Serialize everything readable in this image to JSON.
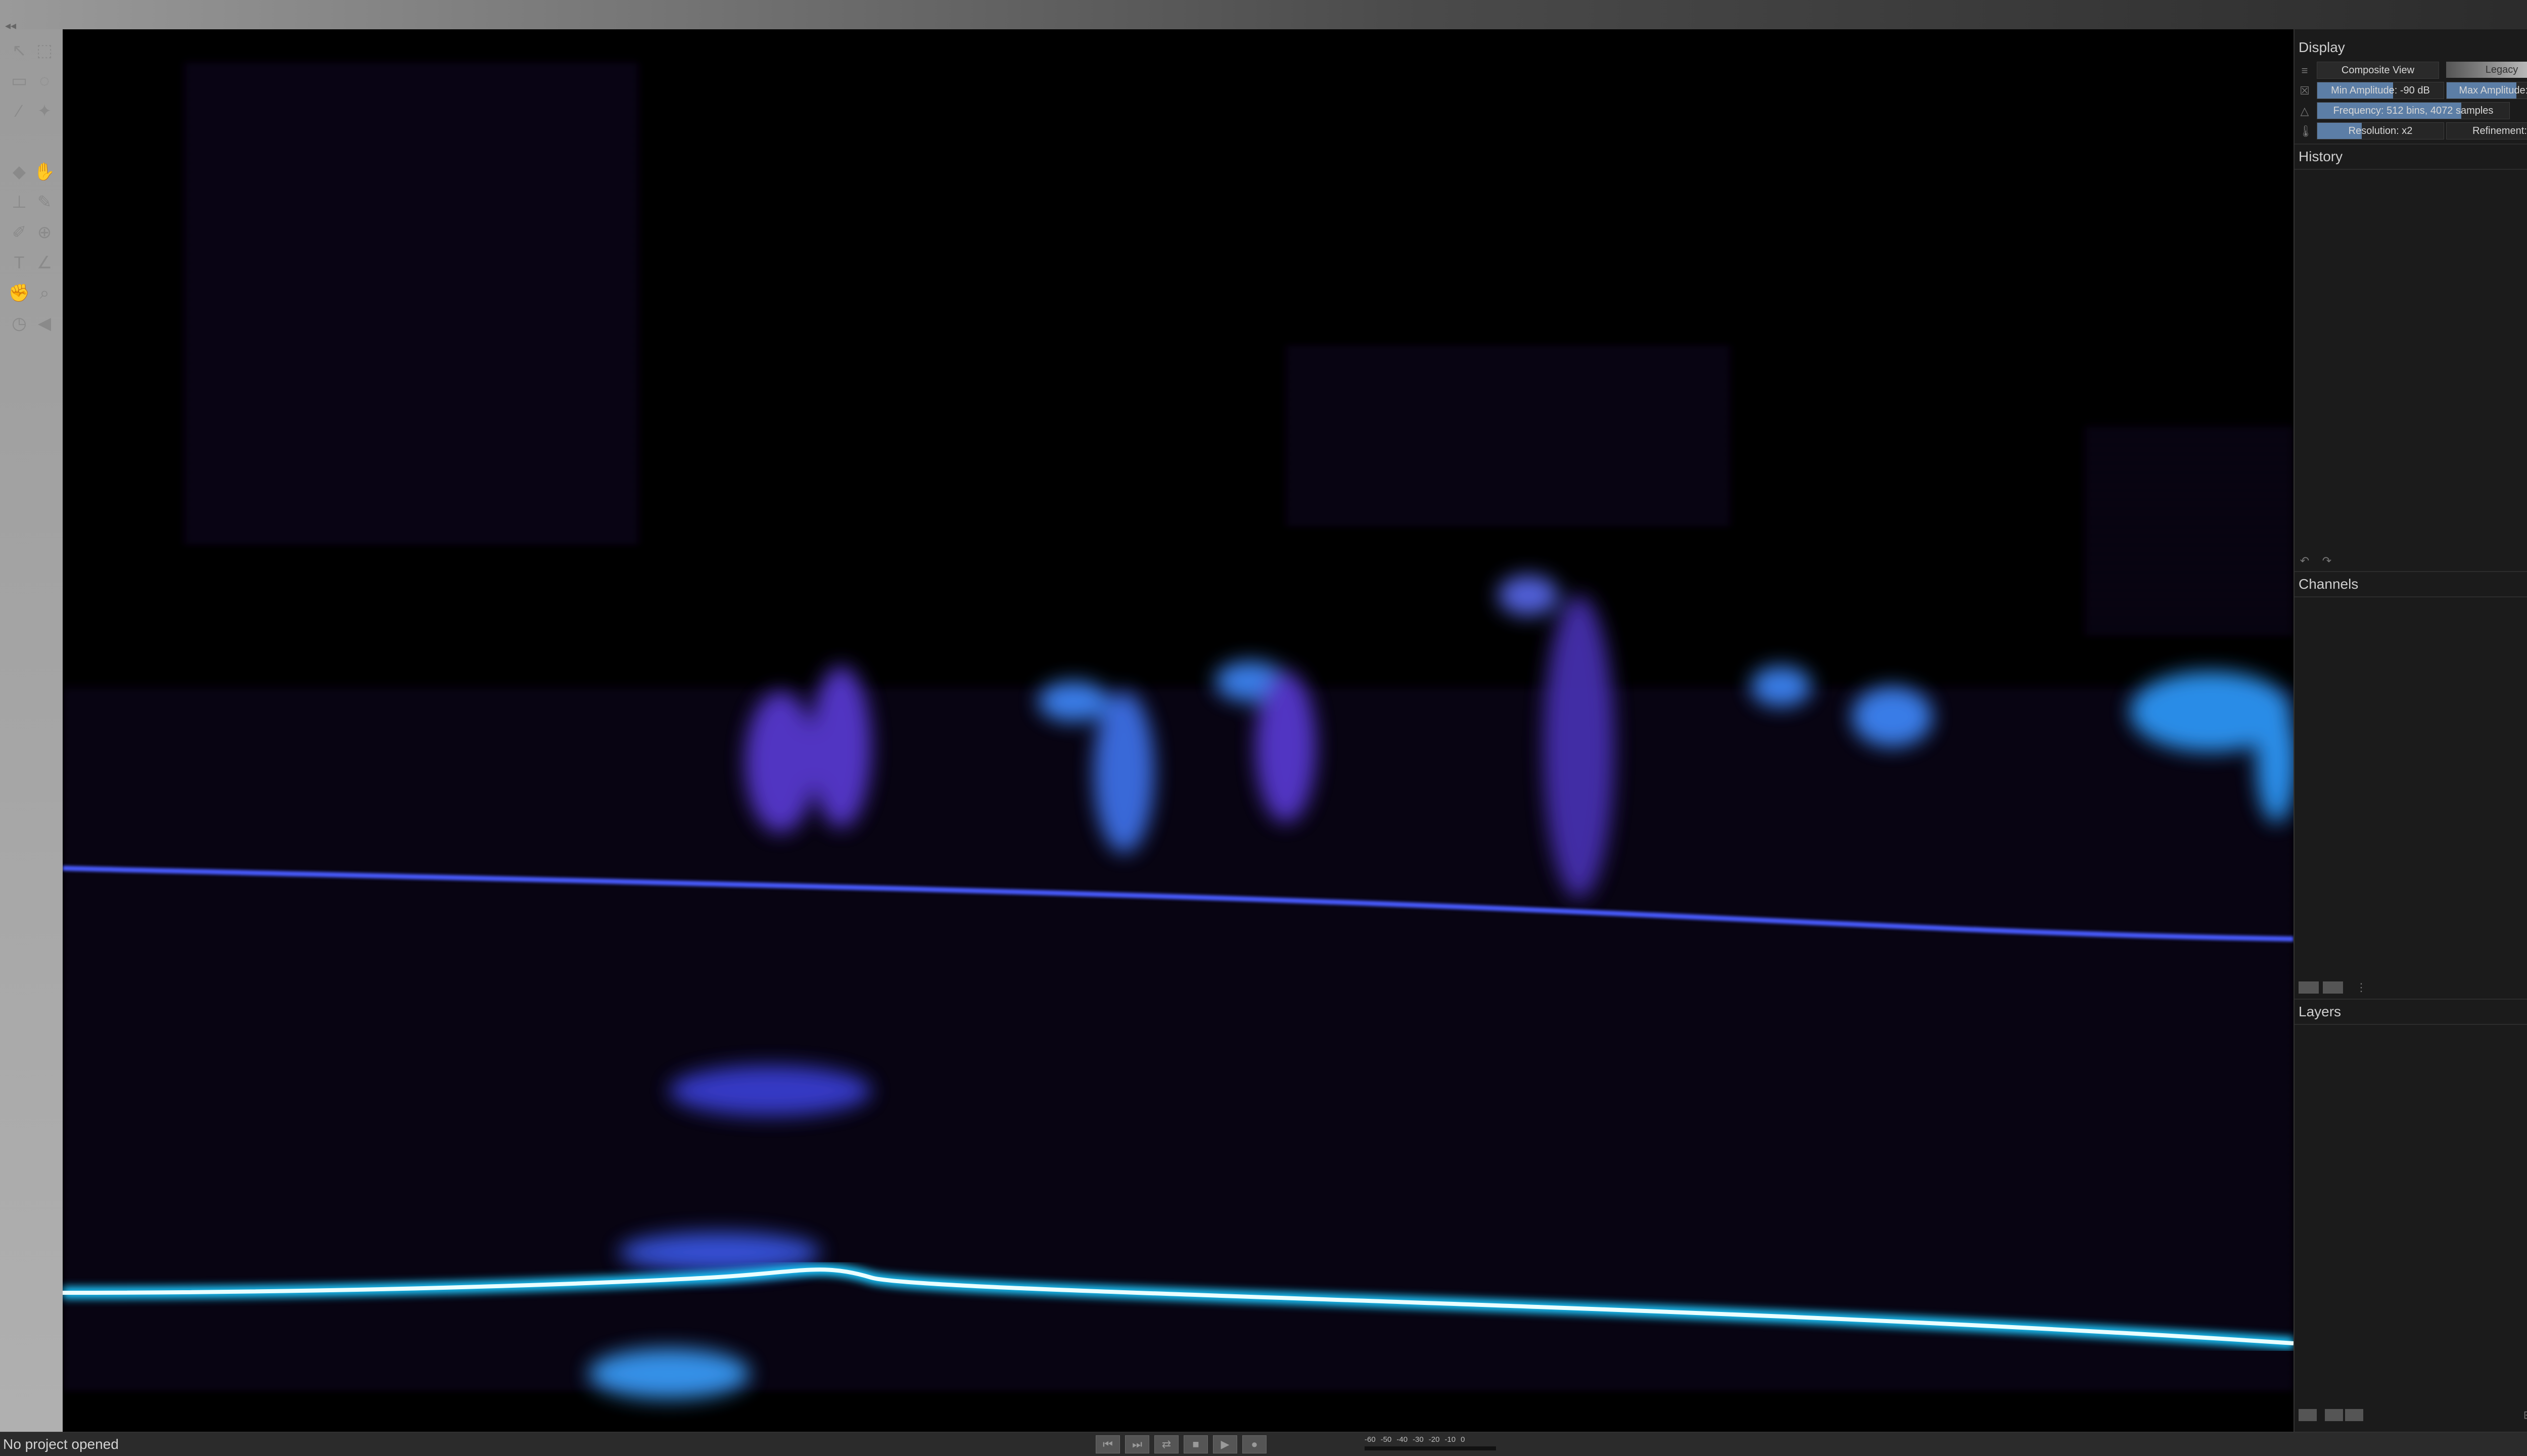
{
  "topbar": {
    "left_arrow": "◂◂",
    "right_arrow": "▸▸"
  },
  "toolbar": {
    "tools": [
      "pointer-tool",
      "select-tool",
      "box-select-tool",
      "lasso-tool",
      "brush-tool",
      "wand-tool",
      "eraser-tool",
      "hand-tool",
      "stamp-tool",
      "pen-tool",
      "pencil-tool",
      "clone-tool",
      "text-tool",
      "dropper-tool",
      "grab-tool",
      "zoom-tool",
      "time-tool",
      "speaker-tool"
    ]
  },
  "panels": {
    "display": {
      "title": "Display",
      "composite_view_label": "Composite View",
      "colormap_label": "Legacy",
      "min_amplitude_label": "Min Amplitude: -90 dB",
      "max_amplitude_label": "Max Amplitude: -18 dB",
      "fft_label": "Frequency: 512 bins, 4072 samples",
      "resolution_label": "Resolution: x2",
      "refinement_label": "Refinement: 0 %"
    },
    "history": {
      "title": "History"
    },
    "channels": {
      "title": "Channels"
    },
    "layers": {
      "title": "Layers"
    }
  },
  "status": {
    "text": "No project opened",
    "meter_ticks": [
      "-60",
      "-50",
      "-40",
      "-30",
      "-20",
      "-10",
      "0"
    ]
  },
  "transport": {
    "buttons": [
      "⏮",
      "⏭",
      "⇄",
      "■",
      "▶",
      "●"
    ]
  },
  "colors": {
    "spectrogram_bg": "#000000",
    "spectrogram_low": "#3a1c78",
    "spectrogram_high": "#1e9cff",
    "spectrogram_peak": "#e8ffff",
    "accent": "#5c7ea6"
  }
}
